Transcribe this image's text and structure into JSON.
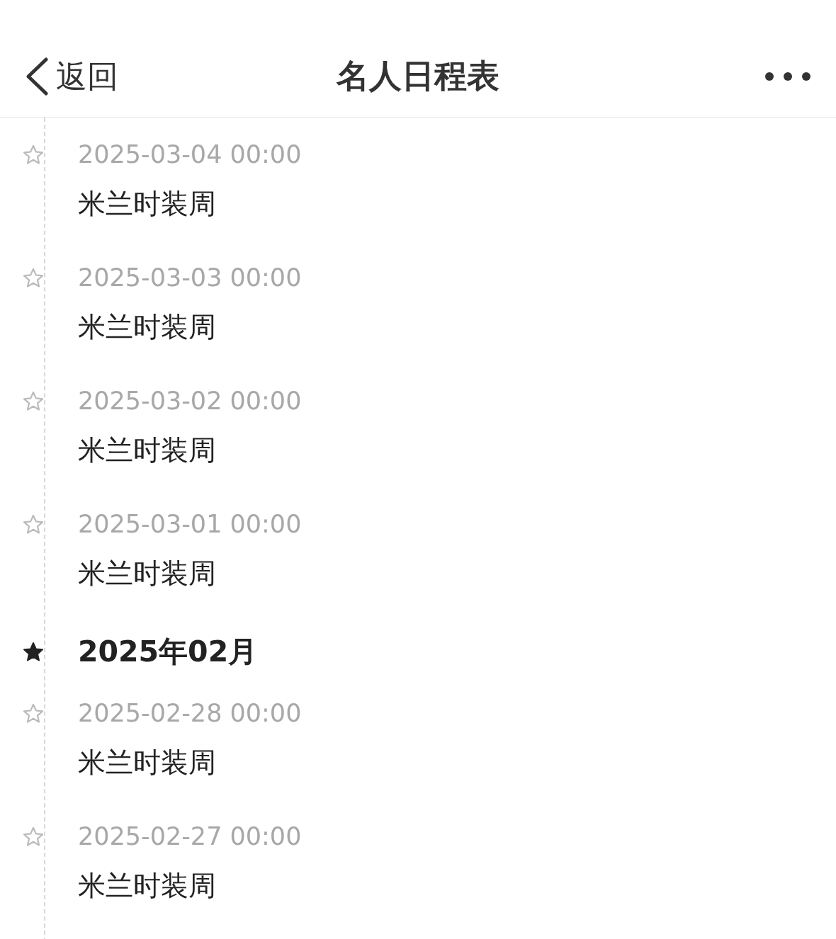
{
  "header": {
    "back_label": "返回",
    "title": "名人日程表"
  },
  "timeline": [
    {
      "kind": "event",
      "date": "2025-03-04 00:00",
      "title": "米兰时装周"
    },
    {
      "kind": "event",
      "date": "2025-03-03 00:00",
      "title": "米兰时装周"
    },
    {
      "kind": "event",
      "date": "2025-03-02 00:00",
      "title": "米兰时装周"
    },
    {
      "kind": "event",
      "date": "2025-03-01 00:00",
      "title": "米兰时装周"
    },
    {
      "kind": "month",
      "label": "2025年02月"
    },
    {
      "kind": "event",
      "date": "2025-02-28 00:00",
      "title": "米兰时装周"
    },
    {
      "kind": "event",
      "date": "2025-02-27 00:00",
      "title": "米兰时装周"
    }
  ]
}
